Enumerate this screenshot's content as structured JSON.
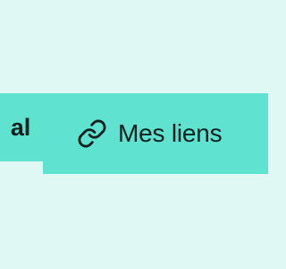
{
  "nav": {
    "tabs": [
      {
        "label": "al",
        "active": true
      },
      {
        "label": "Mes liens",
        "icon": "link-icon",
        "active": false
      }
    ]
  },
  "colors": {
    "background": "#e0f8f4",
    "tab_background": "#5fe2cf",
    "text": "#10201f"
  }
}
